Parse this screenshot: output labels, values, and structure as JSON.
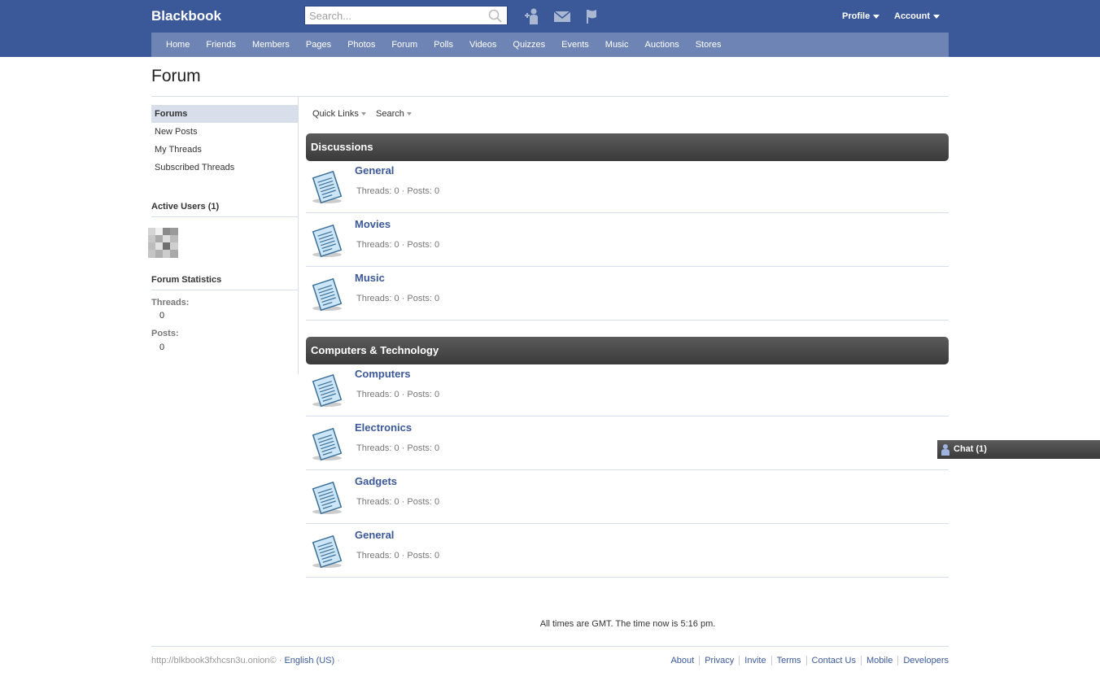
{
  "header": {
    "brand": "Blackbook",
    "search_placeholder": "Search...",
    "profile_label": "Profile",
    "account_label": "Account"
  },
  "nav": [
    "Home",
    "Friends",
    "Members",
    "Pages",
    "Photos",
    "Forum",
    "Polls",
    "Videos",
    "Quizzes",
    "Events",
    "Music",
    "Auctions",
    "Stores"
  ],
  "page": {
    "title": "Forum"
  },
  "sidebar": {
    "links": [
      "Forums",
      "New Posts",
      "My Threads",
      "Subscribed Threads"
    ],
    "active_users_title": "Active Users (1)",
    "stats_title": "Forum Statistics",
    "threads_label": "Threads:",
    "threads_value": "0",
    "posts_label": "Posts:",
    "posts_value": "0"
  },
  "toolbar": {
    "quick_links": "Quick Links",
    "search": "Search"
  },
  "categories": [
    {
      "name": "Discussions",
      "forums": [
        {
          "name": "General",
          "stats": "Threads: 0 · Posts: 0"
        },
        {
          "name": "Movies",
          "stats": "Threads: 0 · Posts: 0"
        },
        {
          "name": "Music",
          "stats": "Threads: 0 · Posts: 0"
        }
      ]
    },
    {
      "name": "Computers & Technology",
      "forums": [
        {
          "name": "Computers",
          "stats": "Threads: 0 · Posts: 0"
        },
        {
          "name": "Electronics",
          "stats": "Threads: 0 · Posts: 0"
        },
        {
          "name": "Gadgets",
          "stats": "Threads: 0 · Posts: 0"
        },
        {
          "name": "General",
          "stats": "Threads: 0 · Posts: 0"
        }
      ]
    }
  ],
  "chat": {
    "label": "Chat (1)"
  },
  "footer": {
    "time_note": "All times are GMT. The time now is 5:16 pm.",
    "site": "http://blkbook3fxhcsn3u.onion© ·",
    "language": "English (US)",
    "lang_sep": "·",
    "links": [
      "About",
      "Privacy",
      "Invite",
      "Terms",
      "Contact Us",
      "Mobile",
      "Developers"
    ]
  },
  "colors": {
    "brand_blue": "#3b5998",
    "nav_blue": "#6d84b4",
    "header_dark": "#444444"
  },
  "icons": [
    "search-icon",
    "friend-requests-icon",
    "messages-icon",
    "notifications-flag-icon",
    "document-icon",
    "chat-user-icon"
  ]
}
